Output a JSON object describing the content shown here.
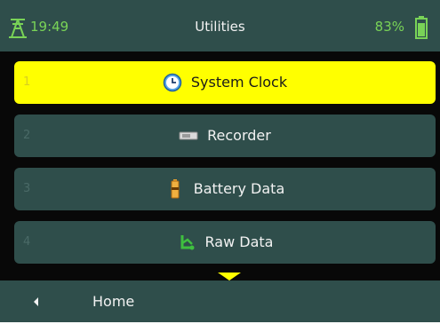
{
  "status_bar": {
    "time": "19:49",
    "title": "Utilities",
    "battery_percent": "83%",
    "signal_icon": "antenna-icon",
    "battery_icon": "battery-icon"
  },
  "menu": {
    "items": [
      {
        "number": "1",
        "label": "System Clock",
        "icon": "clock-icon",
        "selected": true
      },
      {
        "number": "2",
        "label": "Recorder",
        "icon": "recorder-icon",
        "selected": false
      },
      {
        "number": "3",
        "label": "Battery Data",
        "icon": "battery-data-icon",
        "selected": false
      },
      {
        "number": "4",
        "label": "Raw Data",
        "icon": "raw-data-icon",
        "selected": false
      }
    ],
    "more_below_icon": "chevron-down-icon"
  },
  "bottom_bar": {
    "back_icon": "chevron-left-icon",
    "home_label": "Home"
  },
  "colors": {
    "panel": "#2f4e4b",
    "background": "#080808",
    "selected": "#ffff00",
    "accent_green": "#79d357",
    "text": "#f2f2f2"
  }
}
